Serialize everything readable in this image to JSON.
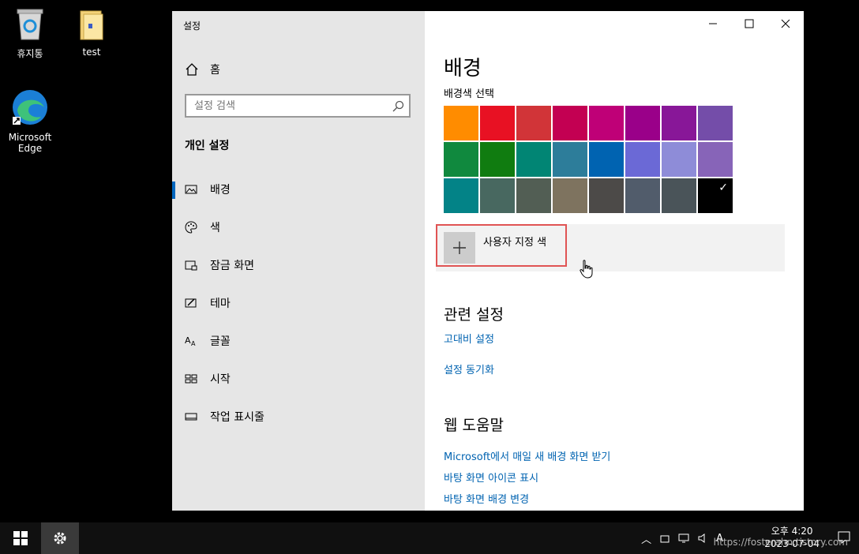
{
  "desktop": {
    "icons": [
      {
        "label": "휴지통"
      },
      {
        "label": "test"
      },
      {
        "label": "Microsoft Edge"
      }
    ]
  },
  "window": {
    "title": "설정",
    "controls": [
      "minimize",
      "maximize",
      "close"
    ]
  },
  "sidebar": {
    "home_label": "홈",
    "search_placeholder": "설정 검색",
    "section_title": "개인 설정",
    "items": [
      {
        "label": "배경",
        "icon": "image-icon",
        "active": true
      },
      {
        "label": "색",
        "icon": "palette-icon",
        "active": false
      },
      {
        "label": "잠금 화면",
        "icon": "lock-screen-icon",
        "active": false
      },
      {
        "label": "테마",
        "icon": "theme-icon",
        "active": false
      },
      {
        "label": "글꼴",
        "icon": "font-icon",
        "active": false
      },
      {
        "label": "시작",
        "icon": "start-icon",
        "active": false
      },
      {
        "label": "작업 표시줄",
        "icon": "taskbar-icon",
        "active": false
      }
    ]
  },
  "main": {
    "page_title": "배경",
    "color_label": "배경색 선택",
    "colors": [
      "#FF8C00",
      "#E81123",
      "#D13438",
      "#C30052",
      "#BF0077",
      "#9A0089",
      "#881798",
      "#744DA9",
      "#10893E",
      "#107C10",
      "#018574",
      "#2D7D9A",
      "#0063B1",
      "#6B69D6",
      "#8E8CD8",
      "#8764B8",
      "#038387",
      "#486860",
      "#525E54",
      "#7E735F",
      "#4C4A48",
      "#515C6B",
      "#4A5459",
      "#000000"
    ],
    "selected_color": "#000000",
    "custom_color_label": "사용자 지정 색",
    "related_title": "관련 설정",
    "related_links": [
      "고대비 설정",
      "설정 동기화"
    ],
    "web_help_title": "웹 도움말",
    "web_help_links": [
      "Microsoft에서 매일 새 배경 화면 받기",
      "바탕 화면 아이콘 표시",
      "바탕 화면 배경 변경"
    ]
  },
  "taskbar": {
    "time": "오후 4:20",
    "date": "2023-07-04",
    "ime": "A",
    "watermark": "https://fosterahn.tistory.com"
  }
}
